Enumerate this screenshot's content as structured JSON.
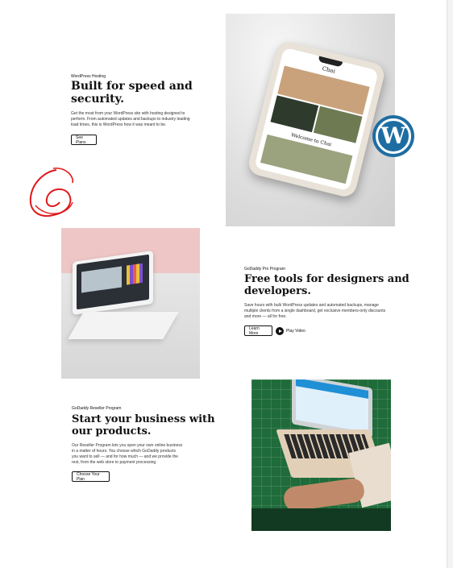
{
  "sections": [
    {
      "eyebrow": "WordPress Hosting",
      "heading_line1": "Built for speed  and",
      "heading_line2": "security.",
      "body_lines": [
        "Get the most from your WordPress site with hosting designed to",
        "perform. From automated updates and backups to industry leading",
        "load times, this is WordPress how it was meant to be."
      ],
      "button": "See Plans"
    },
    {
      "eyebrow": "GoDaddy Pro Program",
      "heading_line1": "Free tools for designers and",
      "heading_line2": "developers.",
      "body_lines": [
        "Save hours with bulk WordPress updates and automated backups, manage",
        "multiple clients from a single dashboard, get exclusive members-only discounts",
        "and more — all for free."
      ],
      "button": "Learn More",
      "secondary": "Play Video"
    },
    {
      "eyebrow": "GoDaddy Reseller Program",
      "heading_line1": "Start your business with",
      "heading_line2": "our products.",
      "body_lines": [
        "Our Reseller Program lets you open your own online business",
        "in a matter of hours. You choose which GoDaddy products",
        "you want to sell — and for how much — and we provide the",
        "rest, from the web store to payment processing."
      ],
      "button": "Choose Your Plan"
    }
  ],
  "phone_screen": {
    "app_title": "Chai",
    "welcome": "Welcome to Chai"
  },
  "colors": {
    "wp_blue": "#1e6da2",
    "annotation_red": "#e0191b",
    "laptop_bg_pink": "#eec6c6",
    "mat_green": "#1f6b3a"
  },
  "icons": {
    "brand_badge": "wordpress-logo-icon",
    "play": "play-icon"
  }
}
